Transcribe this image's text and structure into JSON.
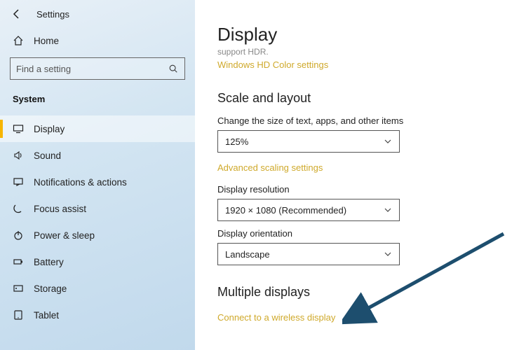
{
  "window": {
    "title": "Settings"
  },
  "sidebar": {
    "home": "Home",
    "search_placeholder": "Find a setting",
    "group": "System",
    "items": [
      {
        "label": "Display"
      },
      {
        "label": "Sound"
      },
      {
        "label": "Notifications & actions"
      },
      {
        "label": "Focus assist"
      },
      {
        "label": "Power & sleep"
      },
      {
        "label": "Battery"
      },
      {
        "label": "Storage"
      },
      {
        "label": "Tablet"
      }
    ]
  },
  "main": {
    "title": "Display",
    "hdr_hint": "support HDR.",
    "hdr_link": "Windows HD Color settings",
    "scale_heading": "Scale and layout",
    "scale_label": "Change the size of text, apps, and other items",
    "scale_value": "125%",
    "adv_scaling": "Advanced scaling settings",
    "res_label": "Display resolution",
    "res_value": "1920 × 1080 (Recommended)",
    "orient_label": "Display orientation",
    "orient_value": "Landscape",
    "multi_heading": "Multiple displays",
    "wireless_link": "Connect to a wireless display"
  }
}
